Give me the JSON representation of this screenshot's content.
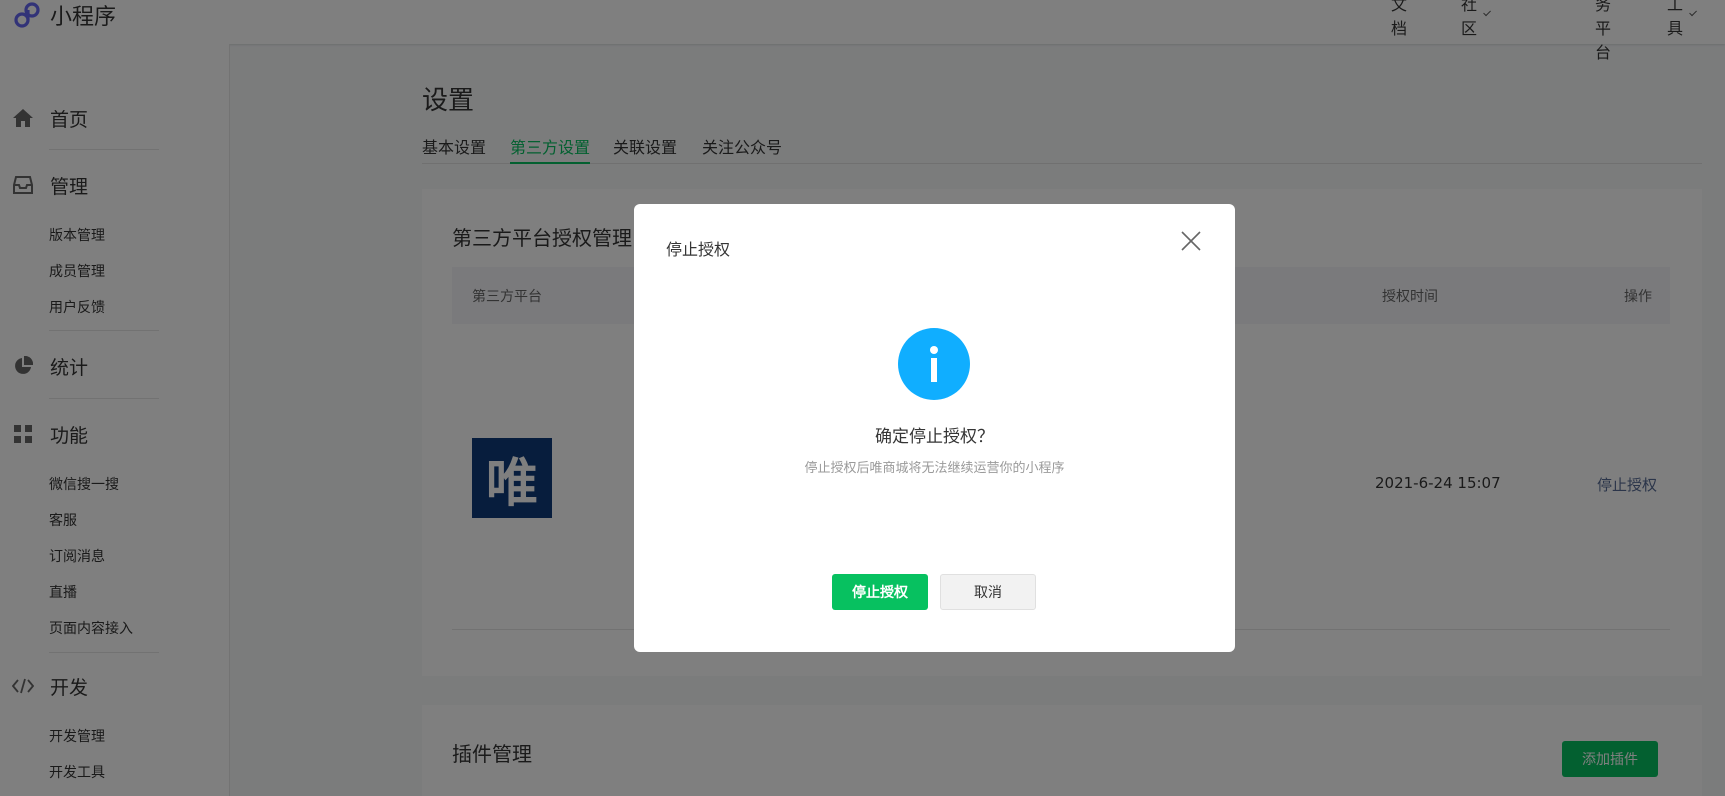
{
  "app": {
    "title": "小程序"
  },
  "topnav": {
    "docs": "文档",
    "community": "社区",
    "service_platform": "服务平台",
    "tools": "工具"
  },
  "sidebar": {
    "home": "首页",
    "manage": "管理",
    "manage_items": [
      "版本管理",
      "成员管理",
      "用户反馈"
    ],
    "stats": "统计",
    "features": "功能",
    "features_items": [
      "微信搜一搜",
      "客服",
      "订阅消息",
      "直播",
      "页面内容接入"
    ],
    "develop": "开发",
    "develop_items": [
      "开发管理",
      "开发工具"
    ]
  },
  "main": {
    "title": "设置",
    "tabs": [
      "基本设置",
      "第三方设置",
      "关联设置",
      "关注公众号"
    ],
    "active_tab": "第三方设置"
  },
  "third_party_card": {
    "title": "第三方平台授权管理",
    "headers": {
      "platform": "第三方平台",
      "auth_time": "授权时间",
      "action": "操作"
    },
    "row": {
      "logo_char": "唯",
      "auth_time": "2021-6-24 15:07",
      "action_link": "停止授权"
    }
  },
  "plugin_card": {
    "title": "插件管理",
    "add_button": "添加插件"
  },
  "modal": {
    "title": "停止授权",
    "question": "确定停止授权？",
    "description": "停止授权后唯商城将无法继续运营你的小程序",
    "confirm_button": "停止授权",
    "cancel_button": "取消"
  },
  "colors": {
    "accent": "#07c160",
    "info": "#10aeff",
    "link": "#576b95",
    "brand_logo_bg": "#0f3b7a",
    "overlay": "rgba(0,0,0,0.5)"
  },
  "icons": {
    "logo": "miniprogram-logo-icon",
    "home": "home-icon",
    "manage": "inbox-icon",
    "stats": "pie-chart-icon",
    "features": "grid-icon",
    "develop": "code-icon",
    "close": "close-icon",
    "info": "info-icon"
  }
}
